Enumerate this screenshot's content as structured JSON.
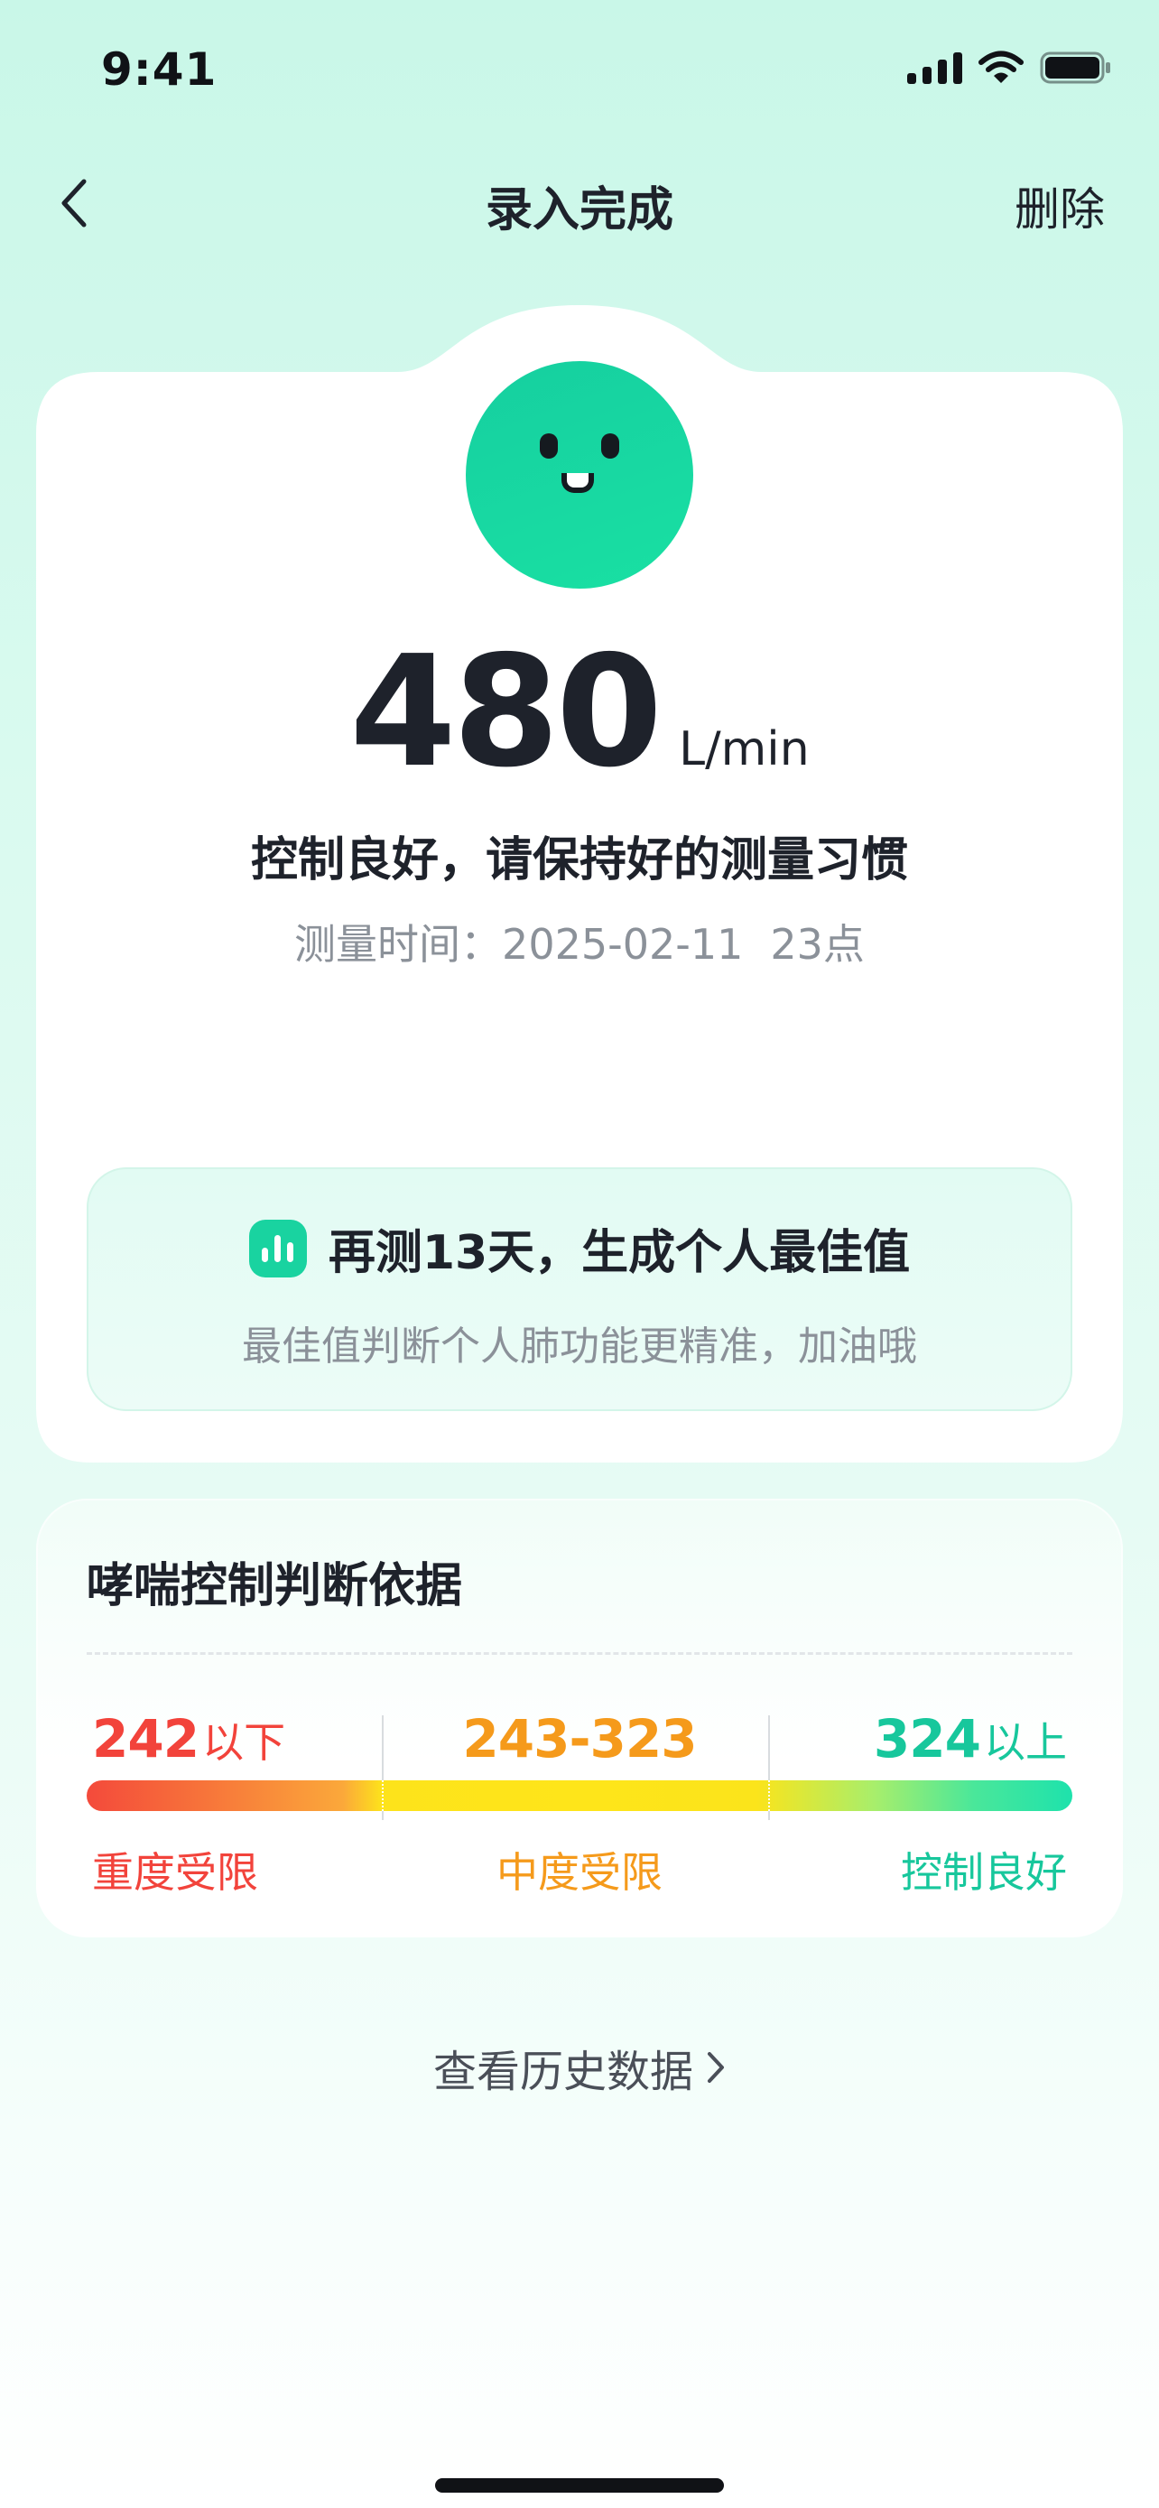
{
  "status_bar": {
    "time": "9:41",
    "icons": [
      "cellular-signal-icon",
      "wifi-icon",
      "battery-icon"
    ]
  },
  "nav": {
    "back_icon": "chevron-left-icon",
    "title": "录入完成",
    "delete_label": "删除"
  },
  "result": {
    "mood_icon": "smiley-face-icon",
    "value": "480",
    "unit": "L/min",
    "status_text": "控制良好，请保持好的测量习惯",
    "time_label": "测量时间：",
    "date": "2025-02-11",
    "hour": "23点"
  },
  "tip": {
    "icon": "bar-chart-icon",
    "title": "再测13天，生成个人最佳值",
    "subtitle": "最佳值判断个人肺功能更精准，加油哦"
  },
  "criteria": {
    "title": "哮喘控制判断依据",
    "ranges": [
      {
        "number": "242",
        "suffix": "以下",
        "level": "重度受限",
        "color": "#f2433b"
      },
      {
        "number": "243-323",
        "suffix": "",
        "level": "中度受限",
        "color": "#f59a1b"
      },
      {
        "number": "324",
        "suffix": "以上",
        "level": "控制良好",
        "color": "#17c79c"
      }
    ]
  },
  "history": {
    "label": "查看历史数据",
    "icon": "chevron-right-icon"
  },
  "colors": {
    "accent": "#19d3a0",
    "severe": "#f2433b",
    "moderate": "#f59a1b",
    "good": "#17c79c",
    "text_primary": "#1e222b",
    "text_secondary": "#8b9199"
  }
}
